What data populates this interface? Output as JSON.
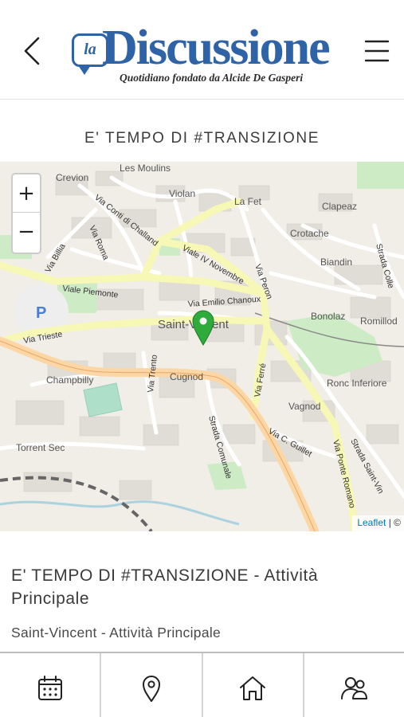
{
  "header": {
    "back_icon": "chevron-left-icon",
    "menu_icon": "hamburger-menu-icon",
    "logo": {
      "badge_text": "la",
      "word": "Discussione",
      "tagline": "Quotidiano fondato da Alcide De Gasperi",
      "color": "#2f63a8"
    }
  },
  "page": {
    "section_title": "E' TEMPO DI #TRANSIZIONE"
  },
  "map": {
    "zoom_in_label": "+",
    "zoom_out_label": "−",
    "attribution_link": "Leaflet",
    "attribution_rest": " | ©",
    "marker_color": "#2eab3a",
    "labels": {
      "crevion": "Crevion",
      "les_moulins": "Les Moulins",
      "violan": "Violan",
      "la_fet": "La Fet",
      "clapeaz": "Clapeaz",
      "crotache": "Crotache",
      "biandin": "Biandin",
      "bonolaz": "Bonolaz",
      "romillod": "Romillod",
      "saint_vincent": "Saint-Vincent",
      "champbilly": "Champbilly",
      "cugnod": "Cugnod",
      "vagnod": "Vagnod",
      "ronc_inferiore": "Ronc Inferiore",
      "torrent_sec": "Torrent Sec",
      "viale_piemonte": "Viale Piemonte",
      "via_trieste": "Via Trieste",
      "viale_iv_novembre": "Viale IV Novembre",
      "via_emilio_chanoux": "Via Emilio Chanoux",
      "via_ferre": "Via Ferré",
      "via_c_guillet": "Via C. Guillet",
      "via_ponte_romano": "Via Ponte Romano",
      "strada_comunale": "Strada Comunale",
      "via_trento": "Via Trento",
      "via_billia": "Via Billia",
      "via_conti_di_challand": "Via Conti di Challand",
      "via_peron": "Via Peron",
      "strada_saint_vin": "Strada Saint-Vin",
      "strada_colle": "Strada Colle",
      "via_roma": "Via Roma",
      "parking": "P"
    }
  },
  "event": {
    "title": "E' TEMPO DI #TRANSIZIONE - Attività Principale",
    "subtitle": "Saint-Vincent - Attività Principale"
  },
  "tabbar": {
    "tabs": [
      {
        "icon": "calendar-icon"
      },
      {
        "icon": "map-pin-icon"
      },
      {
        "icon": "home-icon"
      },
      {
        "icon": "users-icon"
      }
    ]
  }
}
